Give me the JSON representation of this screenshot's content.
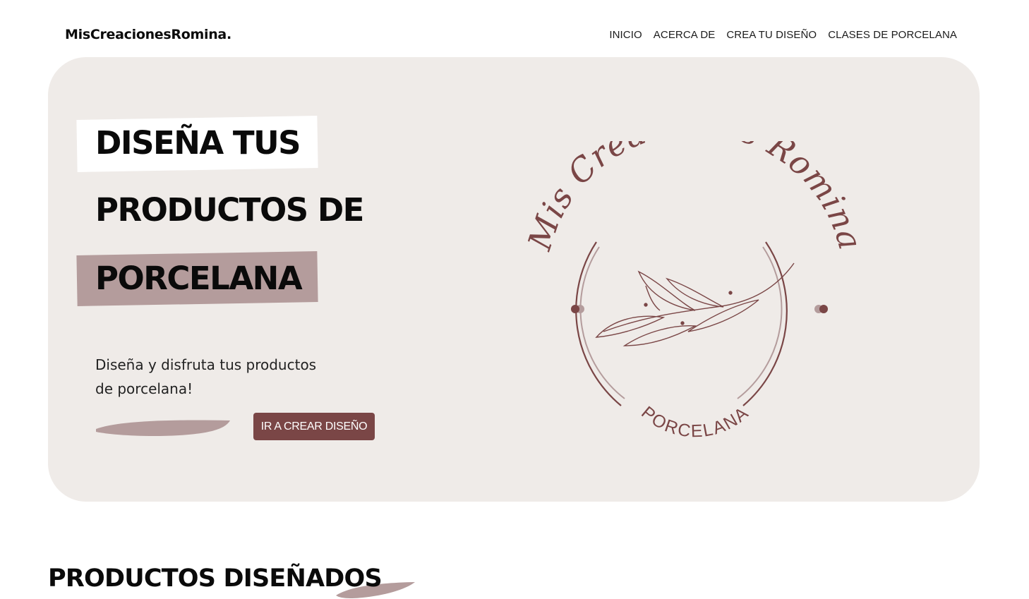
{
  "header": {
    "brand": "MisCreacionesRomina.",
    "nav": [
      {
        "label": "INICIO"
      },
      {
        "label": "ACERCA DE"
      },
      {
        "label": "CREA TU DISEÑO"
      },
      {
        "label": "CLASES DE PORCELANA"
      }
    ]
  },
  "hero": {
    "headline_lines": [
      "DISEÑA TUS",
      "PRODUCTOS DE",
      "PORCELANA"
    ],
    "subtitle_line1": "Diseña y disfruta tus productos",
    "subtitle_line2": "de porcelana!",
    "cta_label": "IR A CREAR DISEÑO",
    "logo": {
      "arc_text": "Mis Creaciones Romina",
      "bottom_text": "PORCELANA"
    }
  },
  "sections": {
    "products_title": "PRODUCTOS DISEÑADOS"
  },
  "colors": {
    "accent": "#7a4646",
    "hero_bg": "#efebe8",
    "mauve": "#b49c9c"
  }
}
